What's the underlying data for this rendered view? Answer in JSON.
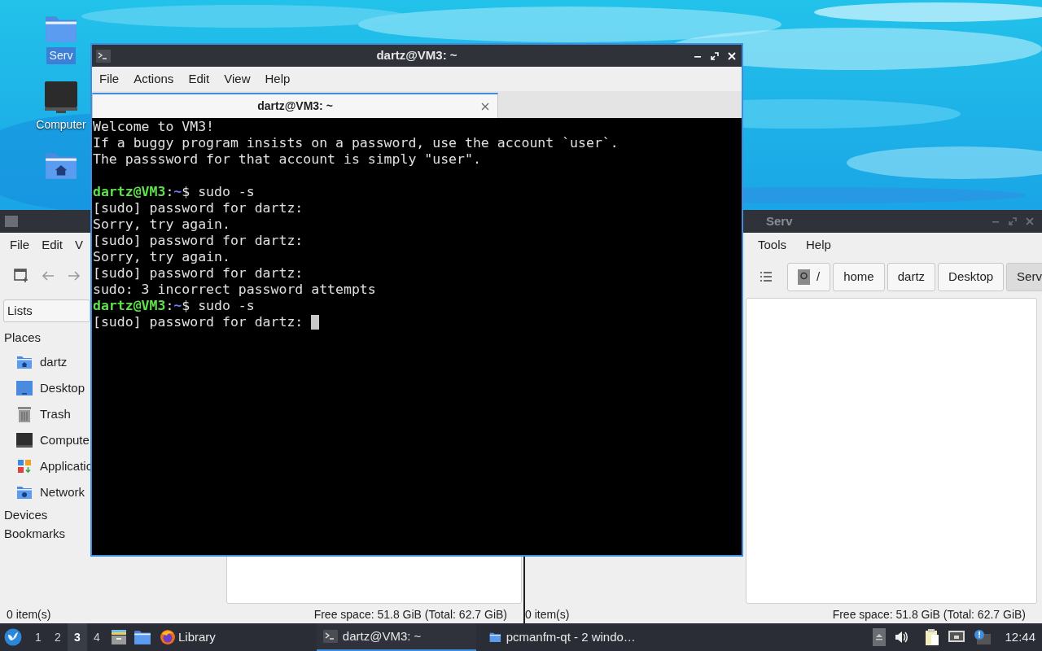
{
  "desktop_icons": [
    {
      "kind": "folder",
      "label": "Serv",
      "selected": true
    },
    {
      "kind": "computer",
      "label": "Computer",
      "selected": false
    },
    {
      "kind": "home-folder"
    }
  ],
  "file_manager": {
    "menu": [
      "File",
      "Edit",
      "V"
    ],
    "side_pane_mode": "Lists",
    "places_heading": "Places",
    "places": [
      {
        "kind": "home",
        "label": "dartz"
      },
      {
        "kind": "desktop",
        "label": "Desktop"
      },
      {
        "kind": "trash",
        "label": "Trash"
      },
      {
        "kind": "computer",
        "label": "Compute"
      },
      {
        "kind": "applications",
        "label": "Applicatio"
      },
      {
        "kind": "network",
        "label": "Network"
      }
    ],
    "sections": [
      "Devices",
      "Bookmarks"
    ],
    "status_left": "0 item(s)",
    "status_right": "Free space: 51.8 GiB (Total: 62.7 GiB)"
  },
  "terminal": {
    "title": "dartz@VM3: ~",
    "menu": [
      "File",
      "Actions",
      "Edit",
      "View",
      "Help"
    ],
    "tabs": [
      {
        "label": "dartz@VM3: ~",
        "selected": true
      }
    ],
    "lines": [
      {
        "kind": "output",
        "text": "Welcome to VM3!"
      },
      {
        "kind": "output",
        "text": "If a buggy program insists on a password, use the account `user`."
      },
      {
        "kind": "output",
        "text": "The passsword for that account is simply \"user\"."
      },
      {
        "kind": "blank"
      },
      {
        "kind": "prompt",
        "user": "dartz@VM3",
        "sep": ":",
        "path": "~",
        "rest": "$ sudo -s"
      },
      {
        "kind": "output",
        "text": "[sudo] password for dartz:"
      },
      {
        "kind": "output",
        "text": "Sorry, try again."
      },
      {
        "kind": "output",
        "text": "[sudo] password for dartz:"
      },
      {
        "kind": "output",
        "text": "Sorry, try again."
      },
      {
        "kind": "output",
        "text": "[sudo] password for dartz:"
      },
      {
        "kind": "output",
        "text": "sudo: 3 incorrect password attempts"
      },
      {
        "kind": "prompt",
        "user": "dartz@VM3",
        "sep": ":",
        "path": "~",
        "rest": "$ sudo -s"
      },
      {
        "kind": "output",
        "text": "[sudo] password for dartz: "
      }
    ],
    "cursor_visible": true
  },
  "folder_window": {
    "title": "Serv",
    "menu": [
      "Tools",
      "Help"
    ],
    "path": [
      {
        "kind": "root",
        "label": "/",
        "selected": false
      },
      {
        "kind": "dir",
        "label": "home",
        "selected": false
      },
      {
        "kind": "dir",
        "label": "dartz",
        "selected": false
      },
      {
        "kind": "dir",
        "label": "Desktop",
        "selected": false
      },
      {
        "kind": "dir",
        "label": "Serv",
        "selected": true
      }
    ],
    "status_left": "0 item(s)",
    "status_right": "Free space: 51.8 GiB (Total: 62.7 GiB)"
  },
  "taskbar": {
    "workspaces": [
      {
        "label": "1",
        "selected": false
      },
      {
        "label": "2",
        "selected": false
      },
      {
        "label": "3",
        "selected": true
      },
      {
        "label": "4",
        "selected": false
      }
    ],
    "launchers": [
      {
        "kind": "file-cabinet"
      },
      {
        "kind": "folder"
      },
      {
        "kind": "browser",
        "label": "Library"
      }
    ],
    "tasks": [
      {
        "kind": "terminal",
        "label": "dartz@VM3: ~",
        "selected": true
      },
      {
        "kind": "folder",
        "label": "pcmanfm-qt - 2 windo…",
        "selected": false
      }
    ],
    "clock": "12:44"
  }
}
